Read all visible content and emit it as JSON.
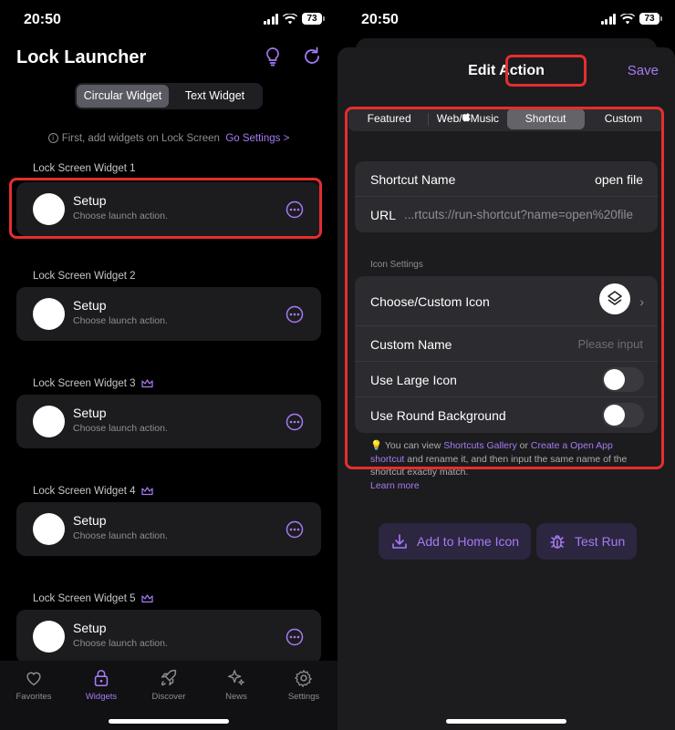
{
  "left": {
    "status": {
      "time": "20:50",
      "battery": "73"
    },
    "title": "Lock Launcher",
    "segmented": [
      "Circular Widget",
      "Text Widget"
    ],
    "hint": {
      "text": "First, add widgets on Lock Screen",
      "link": "Go Settings >"
    },
    "widgets": [
      {
        "label": "Lock Screen Widget 1",
        "title": "Setup",
        "subtitle": "Choose launch action."
      },
      {
        "label": "Lock Screen Widget 2",
        "title": "Setup",
        "subtitle": "Choose launch action."
      },
      {
        "label": "Lock Screen Widget 3",
        "title": "Setup",
        "subtitle": "Choose launch action."
      },
      {
        "label": "Lock Screen Widget 4",
        "title": "Setup",
        "subtitle": "Choose launch action."
      },
      {
        "label": "Lock Screen Widget 5",
        "title": "Setup",
        "subtitle": "Choose launch action."
      }
    ],
    "tabs": [
      "Favorites",
      "Widgets",
      "Discover",
      "News",
      "Settings"
    ],
    "active_tab": "Widgets"
  },
  "right": {
    "status": {
      "time": "20:50",
      "battery": "73"
    },
    "sheet_title": "Edit Action",
    "save": "Save",
    "tabs": [
      "Featured",
      "Web/Music",
      "Shortcut",
      "Custom"
    ],
    "tabs_display": [
      "Featured",
      "Web/Music",
      "Shortcut",
      "Custom"
    ],
    "active_tab": "Shortcut",
    "shortcut_name_label": "Shortcut Name",
    "shortcut_name_value": "open file",
    "url_label": "URL",
    "url_value": "...rtcuts://run-shortcut?name=open%20file",
    "icon_settings_header": "Icon Settings",
    "choose_icon_label": "Choose/Custom Icon",
    "custom_name_label": "Custom Name",
    "custom_name_placeholder": "Please input",
    "large_icon_label": "Use Large Icon",
    "round_bg_label": "Use Round Background",
    "note": {
      "pre": "You can view ",
      "link1": "Shortcuts Gallery",
      "mid": " or ",
      "link2": "Create a Open App shortcut",
      "post": " and rename it, and then input the same name of the shortcut exactly match.",
      "learn": "Learn more"
    },
    "add_home": "Add to Home Icon",
    "test_run": "Test Run"
  },
  "colors": {
    "accent": "#a77bf3",
    "highlight": "#e52e2e"
  }
}
